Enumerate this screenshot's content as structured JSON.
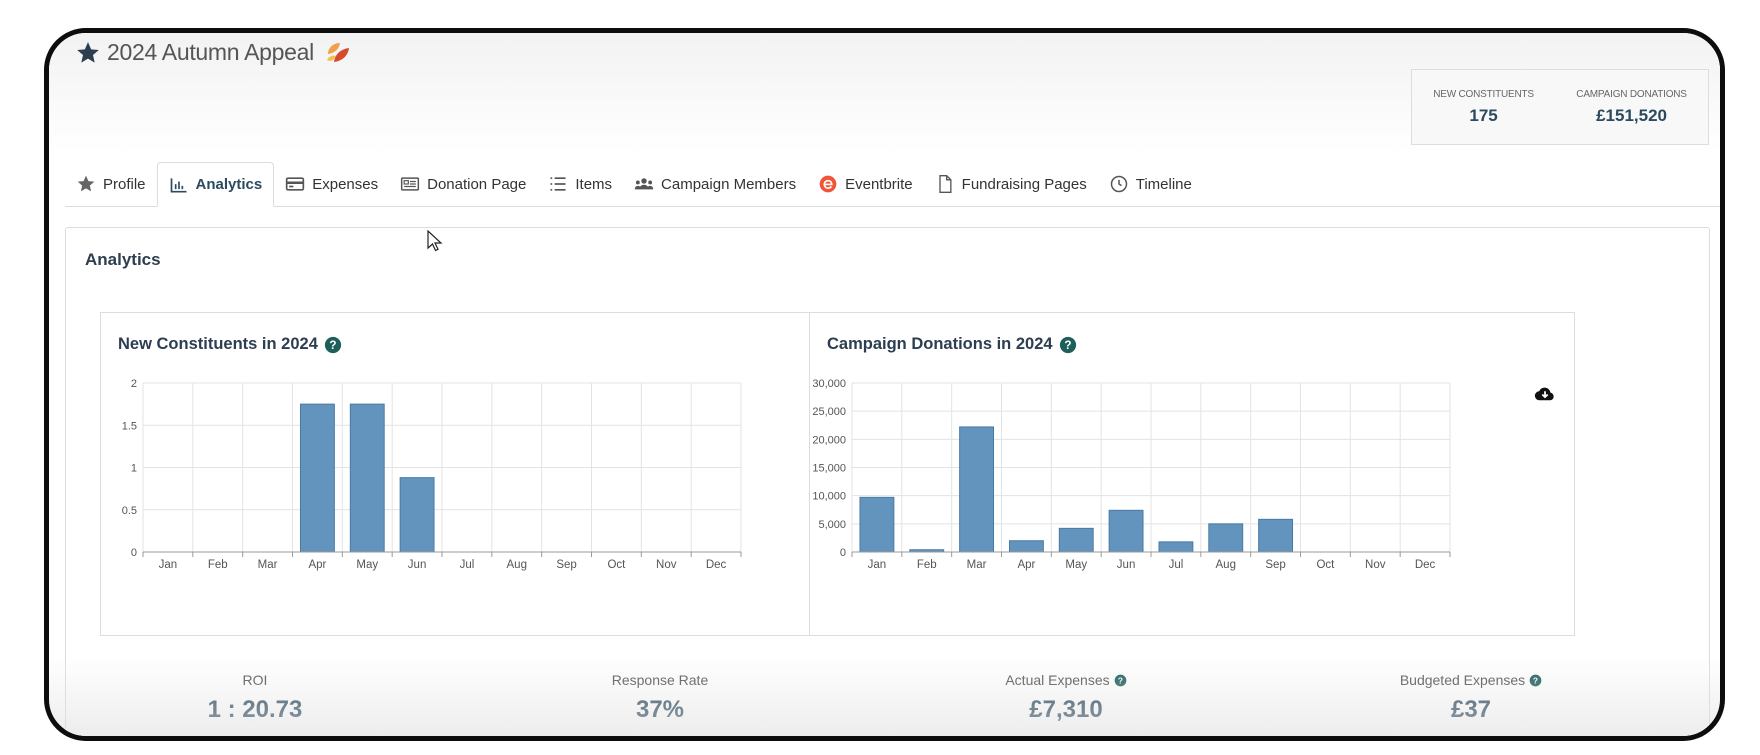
{
  "header": {
    "title": "2024 Autumn Appeal",
    "stats": [
      {
        "label": "NEW CONSTITUENTS",
        "value": "175"
      },
      {
        "label": "CAMPAIGN DONATIONS",
        "value": "£151,520"
      }
    ]
  },
  "tabs": [
    {
      "label": "Profile",
      "icon": "star-icon"
    },
    {
      "label": "Analytics",
      "icon": "bar-chart-icon",
      "active": true
    },
    {
      "label": "Expenses",
      "icon": "credit-card-icon"
    },
    {
      "label": "Donation Page",
      "icon": "newspaper-icon"
    },
    {
      "label": "Items",
      "icon": "list-icon"
    },
    {
      "label": "Campaign Members",
      "icon": "users-icon"
    },
    {
      "label": "Eventbrite",
      "icon": "eventbrite-icon"
    },
    {
      "label": "Fundraising Pages",
      "icon": "file-icon"
    },
    {
      "label": "Timeline",
      "icon": "clock-icon"
    }
  ],
  "panel": {
    "title": "Analytics"
  },
  "colors": {
    "bar": "#6394bd",
    "bar_stroke": "#4a7aa3",
    "accent": "#1f5f5b",
    "kpi": "#2c4a5e"
  },
  "chart_data": [
    {
      "type": "bar",
      "title": "New Constituents in 2024",
      "categories": [
        "Jan",
        "Feb",
        "Mar",
        "Apr",
        "May",
        "Jun",
        "Jul",
        "Aug",
        "Sep",
        "Oct",
        "Nov",
        "Dec"
      ],
      "values": [
        0,
        0,
        0,
        1.75,
        1.75,
        0.88,
        0,
        0,
        0,
        0,
        0,
        0
      ],
      "ylim": [
        0,
        2
      ],
      "yticks": [
        0,
        0.5,
        1,
        1.5,
        2
      ],
      "ytick_labels": [
        "0",
        "0.5",
        "1",
        "1.5",
        "2"
      ],
      "grid": true
    },
    {
      "type": "bar",
      "title": "Campaign Donations in 2024",
      "categories": [
        "Jan",
        "Feb",
        "Mar",
        "Apr",
        "May",
        "Jun",
        "Jul",
        "Aug",
        "Sep",
        "Oct",
        "Nov",
        "Dec"
      ],
      "values": [
        9700,
        400,
        22200,
        2000,
        4200,
        7400,
        1800,
        5000,
        5800,
        0,
        0,
        0
      ],
      "ylim": [
        0,
        30000
      ],
      "yticks": [
        0,
        5000,
        10000,
        15000,
        20000,
        25000,
        30000
      ],
      "ytick_labels": [
        "0",
        "5,000",
        "10,000",
        "15,000",
        "20,000",
        "25,000",
        "30,000"
      ],
      "grid": true
    }
  ],
  "kpis": [
    {
      "label": "ROI",
      "value": "1 : 20.73",
      "help": false
    },
    {
      "label": "Response Rate",
      "value": "37%",
      "help": false
    },
    {
      "label": "Actual Expenses",
      "value": "£7,310",
      "help": true
    },
    {
      "label": "Budgeted Expenses",
      "value": "£37",
      "help": true
    }
  ]
}
